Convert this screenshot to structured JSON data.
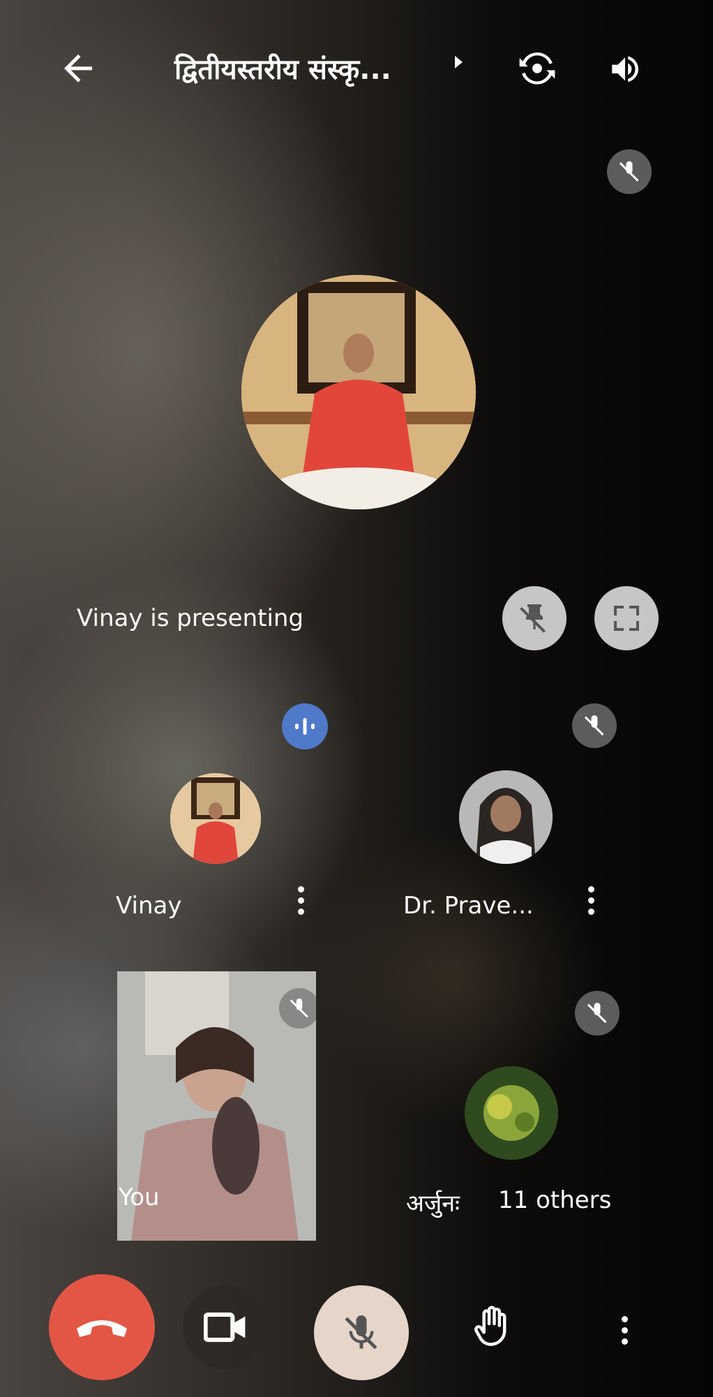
{
  "header": {
    "title": "द्वितीयस्तरीय संस्कृ..."
  },
  "stage": {
    "presenting_text": "Vinay is presenting"
  },
  "participants": [
    {
      "name": "Vinay"
    },
    {
      "name": "Dr. Prave..."
    },
    {
      "name": "You"
    },
    {
      "name": "अर्जुनः"
    }
  ],
  "others_label": "11 others",
  "colors": {
    "end_call": "#e35646",
    "speaking": "#4f79c9",
    "mic_button": "#e6d6c9"
  },
  "icons": {
    "back": "back-arrow-icon",
    "switch_camera": "switch-camera-icon",
    "speaker": "speaker-icon",
    "mic_off": "mic-off-icon",
    "unpin": "unpin-icon",
    "fullscreen": "fullscreen-icon",
    "more": "more-vertical-icon",
    "end_call": "end-call-icon",
    "camera": "camera-icon",
    "raise_hand": "raise-hand-icon"
  }
}
